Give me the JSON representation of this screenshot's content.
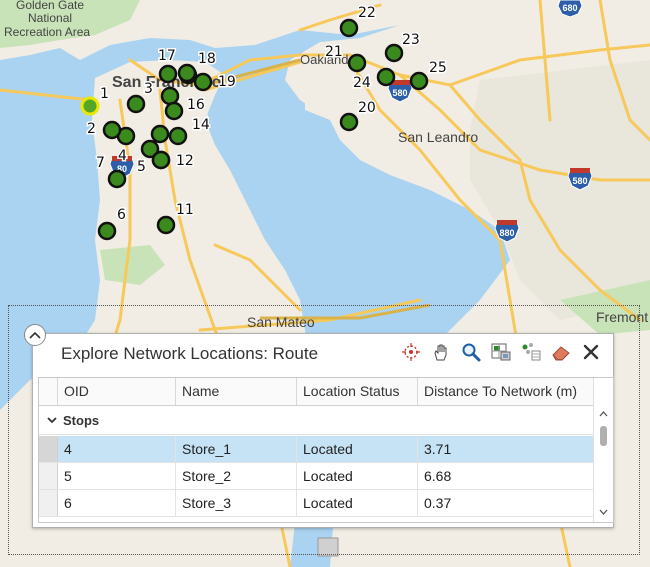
{
  "map": {
    "places": {
      "golden_gate": "Golden Gate",
      "national": "National",
      "recreation_area": "Recreation Area",
      "san_francisco": "San Francisco",
      "oakland": "Oakland",
      "san_leandro": "San Leandro",
      "san_mateo": "San Mateo",
      "fremont": "Fremont"
    },
    "shields": {
      "i580_a": "580",
      "i580_b": "580",
      "i880_a": "880",
      "i880_b": "880",
      "i680": "680",
      "i80": "80"
    },
    "stops": [
      "1",
      "2",
      "3",
      "4",
      "5",
      "6",
      "7",
      "11",
      "12",
      "14",
      "16",
      "17",
      "18",
      "19",
      "20",
      "21",
      "22",
      "23",
      "24",
      "25"
    ],
    "selected_stop": "1"
  },
  "panel": {
    "title": "Explore Network Locations: Route",
    "tools": [
      "location-target-icon",
      "pan-hand-icon",
      "zoom-magnifier-icon",
      "table-image-icon",
      "points-table-icon",
      "eraser-icon",
      "close-icon"
    ],
    "columns": [
      "OID",
      "Name",
      "Location Status",
      "Distance To Network (m)"
    ],
    "group": "Stops",
    "rows": [
      {
        "oid": "4",
        "name": "Store_1",
        "status": "Located",
        "distance": "3.71"
      },
      {
        "oid": "5",
        "name": "Store_2",
        "status": "Located",
        "distance": "6.68"
      },
      {
        "oid": "6",
        "name": "Store_3",
        "status": "Located",
        "distance": "0.37"
      }
    ],
    "selected_row": "4"
  },
  "colors": {
    "water": "#a9d3f0",
    "land": "#f1ede4",
    "park": "#c9e3b8",
    "road": "#f7c85a",
    "stop_fill": "#3a8a1e",
    "selection_highlight": "#c6e2f5",
    "shield_blue": "#2c5fa8",
    "shield_red": "#c0392b"
  }
}
